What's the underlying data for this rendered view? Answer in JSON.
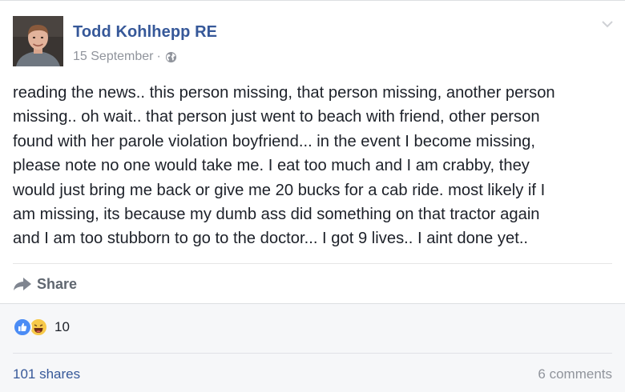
{
  "post": {
    "author": "Todd Kohlhepp RE",
    "date": "15 September",
    "separator": "·",
    "audience_icon": "globe-icon",
    "menu_icon": "chevron-down-icon",
    "body_lines": [
      "reading the news.. this person missing, that person missing, another person",
      "missing.. oh wait.. that person just went to beach with friend, other person",
      "found with her parole violation boyfriend... in the event I become missing,",
      "please note no one would take me. I eat too much and I am crabby, they",
      "would just bring me back or give me 20 bucks for a cab ride. most likely if I",
      "am missing, its because my dumb ass did something on that tractor again",
      "and I am too stubborn to go to the doctor... I got 9 lives.. I aint done yet.."
    ]
  },
  "actions": {
    "share_label": "Share",
    "share_icon": "share-arrow-icon"
  },
  "footer": {
    "reaction_icons": [
      "like-reaction-icon",
      "haha-reaction-icon"
    ],
    "reaction_count": "10",
    "shares": "101 shares",
    "comments": "6 comments"
  },
  "colors": {
    "name_link": "#365899",
    "meta_gray": "#90949c",
    "body_text": "#1d2129",
    "footer_bg": "#f6f7f9",
    "like_blue": "#4b8cf5",
    "haha_yellow": "#f7c94a"
  }
}
